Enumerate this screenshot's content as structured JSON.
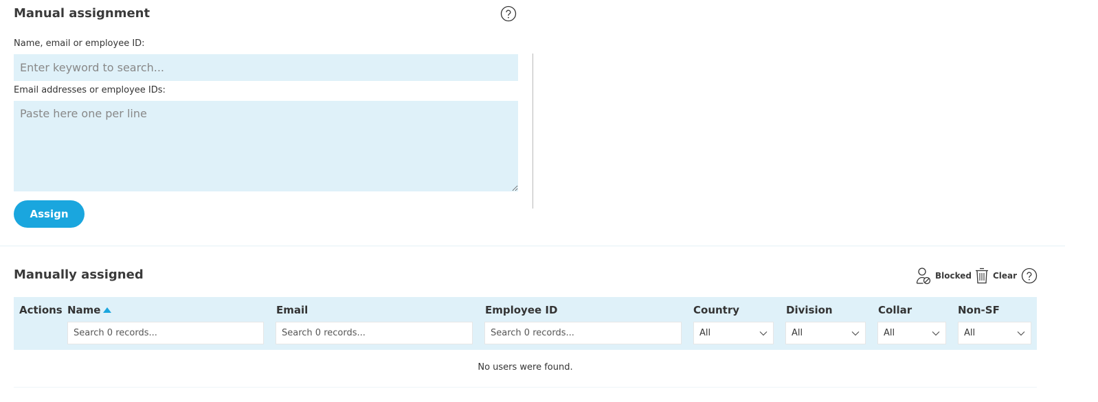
{
  "manual_assignment": {
    "title": "Manual assignment",
    "search_label": "Name, email or employee ID:",
    "search_placeholder": "Enter keyword to search...",
    "paste_label": "Email addresses or employee IDs:",
    "paste_placeholder": "Paste here one per line",
    "assign_label": "Assign"
  },
  "manually_assigned": {
    "title": "Manually assigned",
    "toolbar": {
      "blocked_label": "Blocked",
      "blocked_icon": "user-blocked-icon",
      "clear_label": "Clear",
      "clear_icon": "trash-icon",
      "help_icon": "help-icon"
    },
    "table": {
      "columns": {
        "actions": "Actions",
        "name": "Name",
        "email": "Email",
        "employee_id": "Employee ID",
        "country": "Country",
        "division": "Division",
        "collar": "Collar",
        "non_sf": "Non-SF"
      },
      "sort": {
        "column": "Name",
        "direction": "ascending"
      },
      "search_placeholder": "Search 0 records...",
      "filters": {
        "country": "All",
        "division": "All",
        "collar": "All",
        "non_sf": "All"
      },
      "empty_message": "No users were found."
    }
  },
  "colors": {
    "accent": "#1aa6de",
    "input_bg": "#dff1f9",
    "text": "#333333"
  }
}
